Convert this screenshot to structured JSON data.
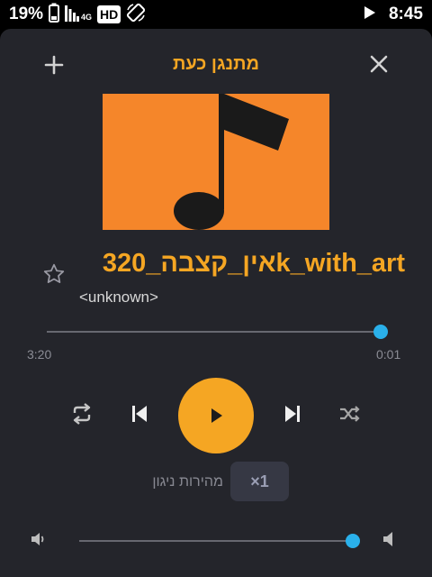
{
  "status_bar": {
    "battery_percent": "19%",
    "network_type": "4G",
    "hd_badge": "HD",
    "time": "8:45"
  },
  "header": {
    "title": "מתנגן כעת"
  },
  "track": {
    "title": "אין_קצבה_320k_with_art",
    "artist": "<unknown>",
    "elapsed_label": "0:01",
    "duration_label": "3:20",
    "progress_fraction": 0.0,
    "favorited": false
  },
  "controls": {
    "speed_label": "מהירות ניגון",
    "speed_value": "×1"
  },
  "volume": {
    "level_fraction": 1.0
  },
  "colors": {
    "accent": "#f5a623",
    "background": "#24252b",
    "slider_knob": "#2ab0ea",
    "album_art": "#f5862a"
  }
}
